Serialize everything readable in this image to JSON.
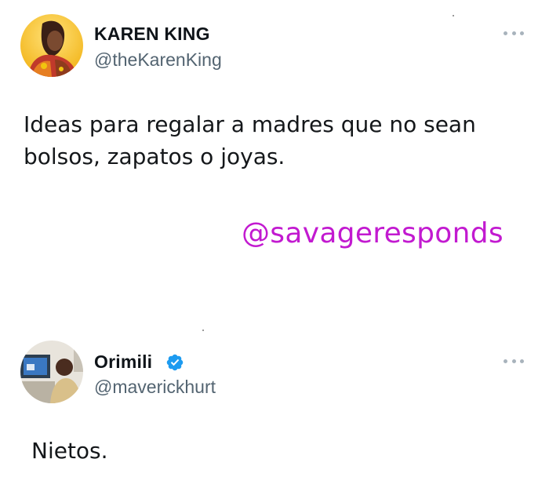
{
  "tweet1": {
    "display_name": "KAREN KING",
    "handle": "@theKarenKing",
    "text_line1": "Ideas para regalar a madres que no sean",
    "text_line2": "bolsos, zapatos o joyas.",
    "more_icon": "ellipsis-icon"
  },
  "watermark": {
    "text": "@savageresponds",
    "color": "#c21ad0"
  },
  "tweet2": {
    "display_name": "Orimili",
    "handle": "@maverickhurt",
    "verified_icon": "verified-badge-icon",
    "text": "Nietos.",
    "more_icon": "ellipsis-icon"
  },
  "colors": {
    "background": "#ffffff",
    "primary_text": "#0f1419",
    "secondary_text": "#536471",
    "verified_blue": "#1d9bf0"
  }
}
